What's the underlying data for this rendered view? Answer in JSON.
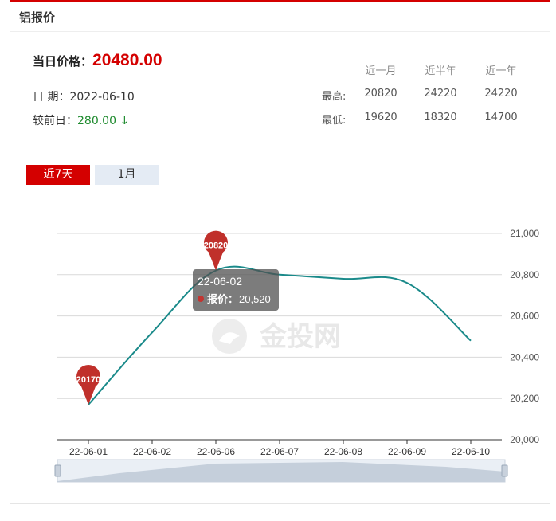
{
  "header": {
    "title": "铝报价"
  },
  "summary": {
    "price_label": "当日价格：",
    "price_value": "20480.00",
    "date_label": "日 期：",
    "date_value": "2022-06-10",
    "change_label": "较前日：",
    "change_value": "280.00",
    "change_arrow": "↓"
  },
  "stats": {
    "headers": [
      "近一月",
      "近半年",
      "近一年"
    ],
    "rows": [
      {
        "label": "最高:",
        "values": [
          "20820",
          "24220",
          "24220"
        ]
      },
      {
        "label": "最低:",
        "values": [
          "19620",
          "18320",
          "14700"
        ]
      }
    ]
  },
  "tabs": [
    {
      "label": "近7天",
      "active": true
    },
    {
      "label": "1月",
      "active": false
    }
  ],
  "chart_data": {
    "type": "line",
    "categories": [
      "22-06-01",
      "22-06-02",
      "22-06-06",
      "22-06-07",
      "22-06-08",
      "22-06-09",
      "22-06-10"
    ],
    "series": [
      {
        "name": "报价",
        "values": [
          20170,
          20520,
          20820,
          20800,
          20780,
          20760,
          20480
        ],
        "color": "#1a8a8a"
      }
    ],
    "ylim": [
      20000,
      21000
    ],
    "yticks": [
      "20,000",
      "20,200",
      "20,400",
      "20,600",
      "20,800",
      "21,000"
    ],
    "markers": [
      {
        "label": "20170",
        "index": 0,
        "value": 20170
      },
      {
        "label": "20820",
        "index": 2,
        "value": 20820
      }
    ],
    "tooltip": {
      "date": "22-06-02",
      "series_label": "报价：",
      "value": "20,520"
    },
    "watermark": "金投网",
    "grid": true,
    "marker_color": "#c0302b"
  }
}
